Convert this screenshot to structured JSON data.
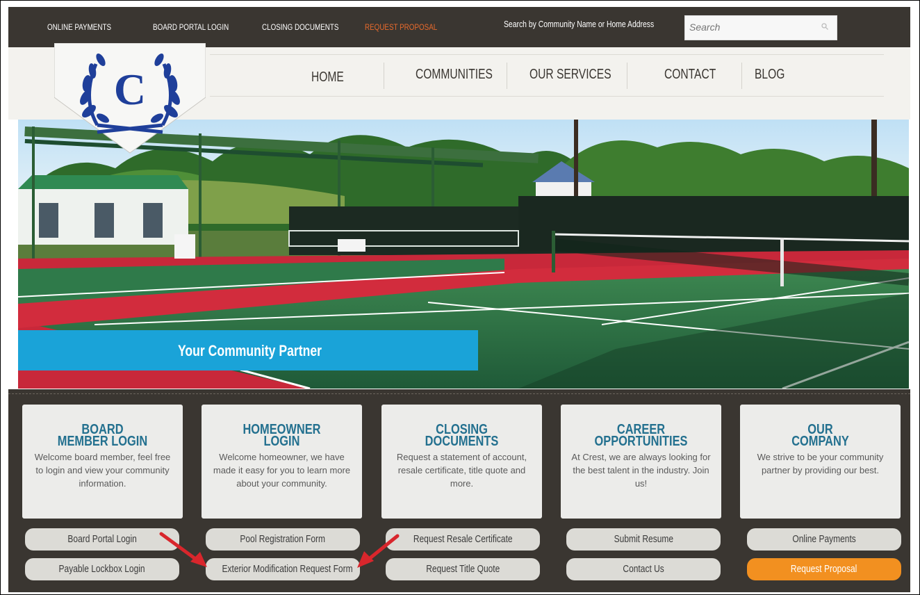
{
  "topbar": {
    "links": [
      "ONLINE PAYMENTS",
      "BOARD PORTAL LOGIN",
      "CLOSING DOCUMENTS",
      "REQUEST PROPOSAL"
    ],
    "search_label": "Search by Community Name or Home Address",
    "search_placeholder": "Search"
  },
  "logo": {
    "letter": "C"
  },
  "nav": {
    "items": [
      "HOME",
      "COMMUNITIES",
      "OUR SERVICES",
      "CONTACT",
      "BLOG"
    ]
  },
  "hero": {
    "tagline": "Your Community Partner"
  },
  "cards": [
    {
      "title": "BOARD\nMEMBER LOGIN",
      "text": "Welcome board member, feel free to login and view your community information.",
      "buttons": [
        "Board Portal Login",
        "Payable Lockbox Login"
      ]
    },
    {
      "title": "HOMEOWNER\nLOGIN",
      "text": "Welcome homeowner, we have made it easy for you to learn more about your community.",
      "buttons": [
        "Pool Registration Form",
        "Exterior Modification Request Form"
      ]
    },
    {
      "title": "CLOSING\nDOCUMENTS",
      "text": "Request a statement of account, resale certificate, title quote and more.",
      "buttons": [
        "Request Resale Certificate",
        "Request Title Quote"
      ]
    },
    {
      "title": "CAREER\nOPPORTUNITIES",
      "text": "At Crest, we are always looking for the best talent in the industry. Join us!",
      "buttons": [
        "Submit Resume",
        "Contact Us"
      ]
    },
    {
      "title": "OUR\nCOMPANY",
      "text": "We strive to be your community partner by providing our best.",
      "buttons": [
        "Online Payments",
        "Request Proposal"
      ]
    }
  ],
  "colors": {
    "dark": "#3a3631",
    "accent_orange": "#f29020",
    "title_blue": "#23708f",
    "tagline_blue": "#1aa3d8",
    "logo_navy": "#1f3f9a"
  }
}
